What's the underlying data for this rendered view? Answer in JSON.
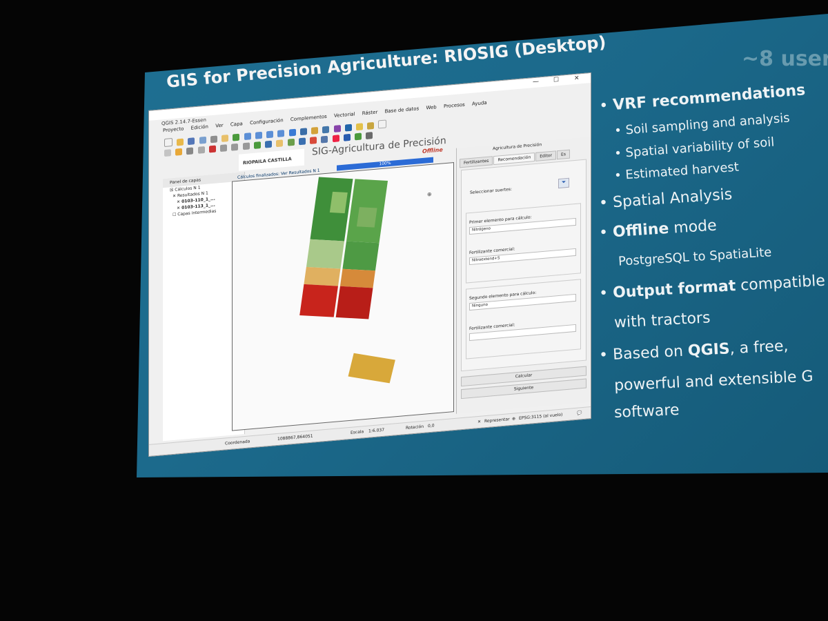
{
  "slide": {
    "title": "GIS for Precision Agriculture: RIOSIG (Desktop)",
    "ghost_text": "~8 user",
    "bullets": [
      {
        "prefix": "• ",
        "bold": "VRF recommendations",
        "rest": ""
      },
      {
        "prefix": "• ",
        "bold": "",
        "rest": "Soil sampling and analysis"
      },
      {
        "prefix": "• ",
        "bold": "",
        "rest": "Spatial variability of soil"
      },
      {
        "prefix": "• ",
        "bold": "",
        "rest": "Estimated harvest"
      },
      {
        "prefix": "• ",
        "bold": "",
        "rest": "Spatial Analysis"
      },
      {
        "prefix": "• ",
        "bold": "Offline",
        "rest": " mode"
      },
      {
        "prefix": "",
        "bold": "",
        "rest": "PostgreSQL to SpatiaLite"
      },
      {
        "prefix": "• ",
        "bold": "Output format",
        "rest": " compatible"
      },
      {
        "prefix": "",
        "bold": "",
        "rest": "with tractors"
      },
      {
        "prefix": "• ",
        "bold": "",
        "rest": "Based on ",
        "bold2": "QGIS",
        "rest2": ", a free,"
      },
      {
        "prefix": "",
        "bold": "",
        "rest": "powerful and extensible G"
      },
      {
        "prefix": "",
        "bold": "",
        "rest": "software"
      }
    ]
  },
  "qgis": {
    "window_title": "QGIS 2.14.7-Essen",
    "window_controls": [
      "—",
      "☐",
      "✕"
    ],
    "menu": [
      "Proyecto",
      "Edición",
      "Ver",
      "Capa",
      "Configuración",
      "Complementos",
      "Vectorial",
      "Ráster",
      "Base de datos",
      "Web",
      "Procesos",
      "Ayuda"
    ],
    "layers_panel": {
      "title": "Panel de capas",
      "items": [
        "Cálculos N 1",
        "Resultados N 1",
        "0103-110_1_...",
        "0103-113_1_...",
        "Capas intermedias"
      ]
    },
    "plugin": {
      "logo_text": "RIOPAILA CASTILLA",
      "title": "SIG-Agricultura de Precisión",
      "offline_label": "Offline",
      "progress_label": "Cálculos finalizados: Ver Resultados N 1",
      "progress_value": "100%",
      "progress_fraction": 1.0
    },
    "right_panel": {
      "title": "Agricultura de Precisión",
      "tabs": [
        "Fertilizantes",
        "Recomendación",
        "Editor",
        "Es"
      ],
      "active_tab": "Recomendación",
      "select_suertes_label": "Seleccionar suertes:",
      "first_element_label": "Primer elemento para cálculo:",
      "first_element_value": "Nitrógeno",
      "fertilizer1_label": "Fertilizante comercial:",
      "fertilizer1_value": "Nitroextend+S",
      "second_element_label": "Segundo elemento para cálculo:",
      "second_element_value": "Ninguno",
      "fertilizer2_label": "Fertilizante comercial:",
      "fertilizer2_value": "",
      "calc_button": "Calcular",
      "next_button": "Siguiente"
    },
    "status": {
      "coord_label": "Coordenada",
      "coord_value": "1088867,864051",
      "scale_label": "Escala",
      "scale_value": "1:6.037",
      "rotation_label": "Rotación",
      "rotation_value": "0,0",
      "render_label": "Representar",
      "crs": "EPSG:3115 (al vuelo)"
    }
  },
  "colors": {
    "slide_bg": "#1c6a8c",
    "room_bg": "#050505",
    "progress": "#2b6bd6",
    "offline": "#c0392b",
    "map_green": "#3f8f3a",
    "map_red": "#c8241c",
    "map_yellow": "#d8a83a"
  }
}
